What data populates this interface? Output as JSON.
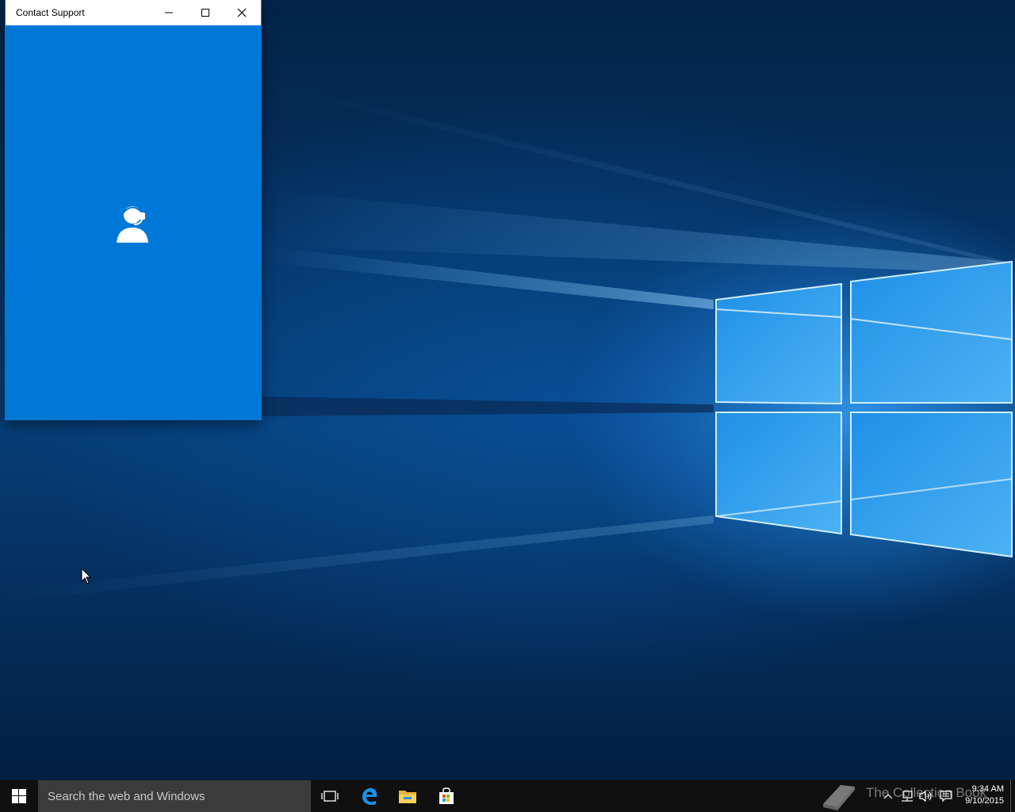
{
  "window": {
    "title": "Contact Support",
    "accent_color": "#0078d7",
    "controls": {
      "minimize": "minimize-icon",
      "maximize": "maximize-icon",
      "close": "close-icon"
    },
    "content_icon": "support-agent-icon"
  },
  "taskbar": {
    "search_placeholder": "Search the web and Windows",
    "pinned": [
      "task-view-icon",
      "edge-icon",
      "file-explorer-icon",
      "store-icon"
    ],
    "watermark_text": "The Collection Book",
    "clock": {
      "time": "9:34 AM",
      "date": "9/10/2015"
    }
  }
}
